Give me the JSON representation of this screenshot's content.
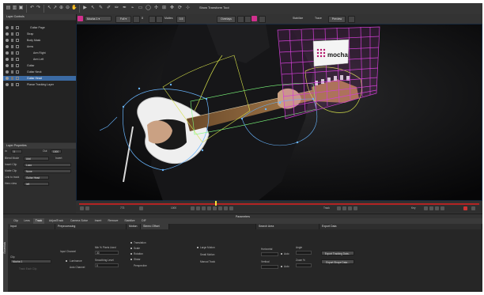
{
  "toolbar": {
    "title": "Show Transform Tool"
  },
  "viewer_bar": {
    "clip": "Mocha 1",
    "zoom": "Full",
    "value_a": "8",
    "value_b": "0.5",
    "label_matte": "Mattes",
    "overlays_btn": "Overlays",
    "stabilize": "Stabilize",
    "trace": "Trace",
    "preview": "Preview"
  },
  "left": {
    "layer_controls_title": "Layer Controls",
    "layers": [
      {
        "name": "Guitar Page",
        "indent": 30,
        "selected": false
      },
      {
        "name": "Strap",
        "indent": 26,
        "selected": false
      },
      {
        "name": "Body Mask",
        "indent": 26,
        "selected": false
      },
      {
        "name": "Arms",
        "indent": 26,
        "selected": false
      },
      {
        "name": "Arm Right",
        "indent": 34,
        "selected": false
      },
      {
        "name": "Arm Left",
        "indent": 34,
        "selected": false
      },
      {
        "name": "Guitar",
        "indent": 26,
        "selected": false
      },
      {
        "name": "Guitar Neck",
        "indent": 26,
        "selected": false
      },
      {
        "name": "Guitar Head",
        "indent": 26,
        "selected": true
      },
      {
        "name": "Planar Tracking Layer",
        "indent": 26,
        "selected": false
      }
    ],
    "layer_properties_title": "Layer Properties",
    "in_label": "In",
    "in_value": "0",
    "out_label": "Out",
    "out_value": "1000",
    "blend_mode_label": "Blend Mode",
    "blend_mode_value": "Add",
    "invert_label": "Invert",
    "insert_clip_label": "Insert Clip",
    "insert_clip_value": "Logo",
    "matte_clip_label": "Matte Clip",
    "matte_clip_value": "None",
    "link_label": "Link to track",
    "link_value": "Guitar Head",
    "view_label": "Hero view",
    "view_value": "left"
  },
  "timeline": {
    "frame_start": "773",
    "frame_end": "1000",
    "track_label": "Track",
    "key_label": "Key"
  },
  "parameters_title": "Parameters",
  "params_vert_label": "Essentials",
  "tabs": [
    "Clip",
    "Lens",
    "Track",
    "AdjustTrack",
    "Camera Solve",
    "Insert",
    "Remove",
    "Stabilize",
    "DIF"
  ],
  "active_tab": 2,
  "params": {
    "input_hdr": "Input",
    "preproc_hdr": "Preprocessing",
    "motion_hdr": "Motion",
    "motion_tab2": "Stereo Offset",
    "search_hdr": "Search Area",
    "export_hdr": "Export Data",
    "clip_label": "Clip",
    "clip_value": "Mocha 1",
    "track_each": "Track Each Clip",
    "input_channel": "Input Channel",
    "luminance": "Luminance",
    "auto_channel": "Auto Channel",
    "min_pct": "Min % Pixels Used",
    "min_pct_value": "30",
    "smoothing": "Smoothing Level",
    "smoothing_value": "0",
    "translation": "Translation",
    "scale": "Scale",
    "rotation": "Rotation",
    "shear": "Shear",
    "perspective": "Perspective",
    "large_motion": "Large Motion",
    "small_motion": "Small Motion",
    "manual_track": "Manual Track",
    "horizontal": "Horizontal",
    "vertical": "Vertical",
    "auto": "Auto",
    "angle": "Angle",
    "zoom_pct": "Zoom %",
    "export_tracking": "Export Tracking Data...",
    "export_shape": "Export Shape Data..."
  },
  "overlay": {
    "logo_text": "mocha"
  },
  "colors": {
    "accent_pink": "#d0308d",
    "timeline_red": "#b32424",
    "selection": "#3b6aa3",
    "grid_magenta": "#d23fd6"
  }
}
